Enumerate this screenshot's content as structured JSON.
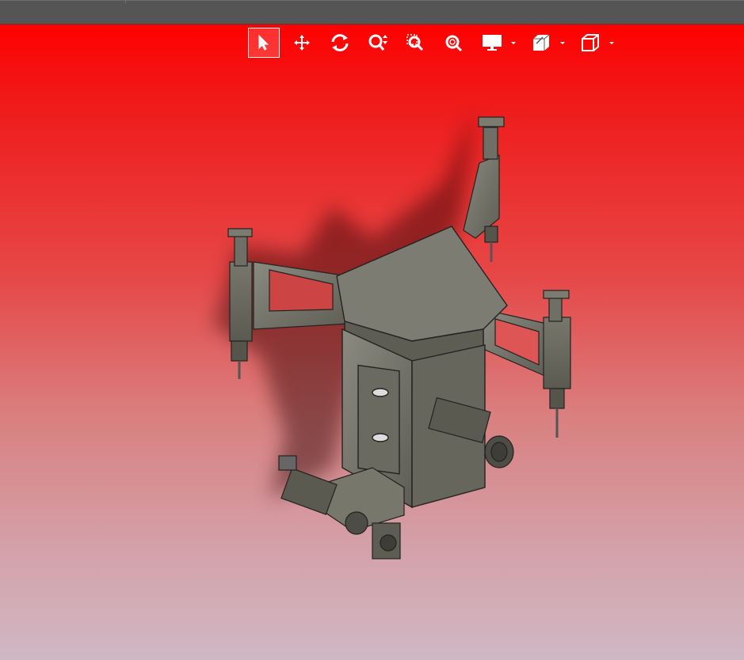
{
  "window": {
    "title": ""
  },
  "toolbar": {
    "buttons": [
      {
        "id": "select",
        "icon": "select-arrow-icon",
        "active": true
      },
      {
        "id": "pan",
        "icon": "pan-move-icon",
        "active": false
      },
      {
        "id": "rotate",
        "icon": "rotate-icon",
        "active": false
      },
      {
        "id": "zoom",
        "icon": "zoom-updown-icon",
        "active": false
      },
      {
        "id": "zoom-window",
        "icon": "zoom-window-icon",
        "active": false
      },
      {
        "id": "zoom-fit",
        "icon": "zoom-fit-icon",
        "active": false
      },
      {
        "id": "display",
        "icon": "monitor-icon",
        "dropdown": true
      },
      {
        "id": "section",
        "icon": "section-cube-icon",
        "dropdown": true
      },
      {
        "id": "view-orientation",
        "icon": "cube-view-icon",
        "dropdown": true
      }
    ]
  },
  "viewport": {
    "background_top": "#ff0000",
    "background_bottom": "#cfb8c4",
    "model_color": "#7a7a6e"
  }
}
